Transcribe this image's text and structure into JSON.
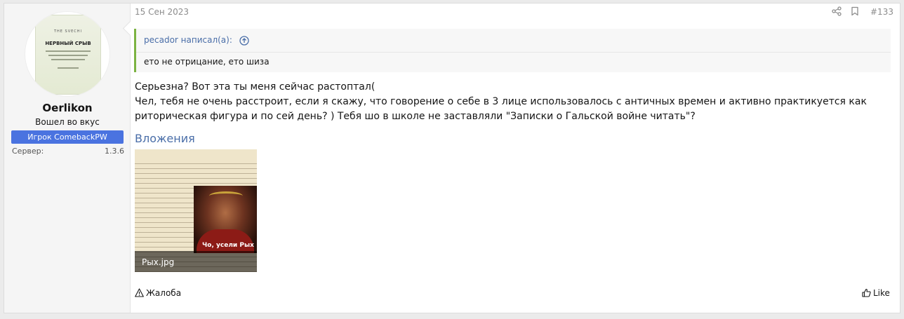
{
  "user": {
    "avatar_brand": "THE SVECHI",
    "avatar_product": "НЕРВНЫЙ СРЫВ",
    "username": "Oerlikon",
    "user_title": "Вошел во вкус",
    "banner": "Игрок ComebackPW",
    "server_label": "Сервер:",
    "server_value": "1.3.6"
  },
  "post": {
    "date": "15 Сен 2023",
    "number": "#133",
    "quote": {
      "author": "pecador написал(а):",
      "text": "ето не отрицание, ето шиза"
    },
    "message_lines": [
      "Серьезна? Вот эта ты меня сейчас растоптал(",
      "Чел, тебя не очень расстроит, если я скажу, что говорение о себе в 3 лице использовалось с античных времен и активно практикуется как",
      "риторическая фигура и по сей день? ) Тебя шо в школе не заставляли \"Записки о Гальской войне читать\"?"
    ],
    "attachments_title": "Вложения",
    "attachment": {
      "filename": "Рых.jpg",
      "caption": "Чо, усели Рых"
    },
    "report_label": "Жалоба",
    "like_label": "Like"
  },
  "colors": {
    "accent": "#4a6ea8",
    "banner": "#4a73e0",
    "quote_border": "#7cb342"
  },
  "icons": [
    "share-icon",
    "bookmark-icon",
    "arrow-up-circle-icon",
    "warning-icon",
    "thumbs-up-icon"
  ]
}
